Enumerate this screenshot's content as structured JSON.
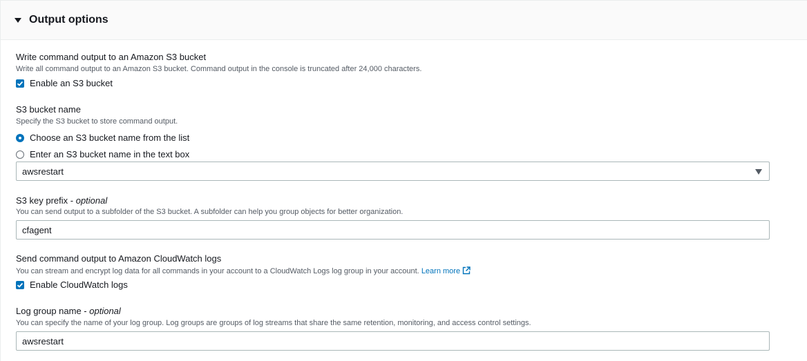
{
  "header": {
    "title": "Output options"
  },
  "s3_output": {
    "label": "Write command output to an Amazon S3 bucket",
    "description": "Write all command output to an Amazon S3 bucket. Command output in the console is truncated after 24,000 characters.",
    "checkbox_label": "Enable an S3 bucket",
    "checked": true
  },
  "bucket_name": {
    "label": "S3 bucket name",
    "description": "Specify the S3 bucket to store command output.",
    "options": [
      {
        "label": "Choose an S3 bucket name from the list",
        "selected": true
      },
      {
        "label": "Enter an S3 bucket name in the text box",
        "selected": false
      }
    ],
    "select_value": "awsrestart"
  },
  "key_prefix": {
    "label": "S3 key prefix",
    "optional": "optional",
    "description": "You can send output to a subfolder of the S3 bucket. A subfolder can help you group objects for better organization.",
    "value": "cfagent"
  },
  "cloudwatch": {
    "label": "Send command output to Amazon CloudWatch logs",
    "description": "You can stream and encrypt log data for all commands in your account to a CloudWatch Logs log group in your account.",
    "learn_more": "Learn more",
    "checkbox_label": "Enable CloudWatch logs",
    "checked": true
  },
  "log_group": {
    "label": "Log group name",
    "optional": "optional",
    "description": "You can specify the name of your log group. Log groups are groups of log streams that share the same retention, monitoring, and access control settings.",
    "value": "awsrestart"
  },
  "colors": {
    "accent": "#0073bb",
    "text": "#16191f",
    "muted": "#545b64",
    "border": "#aab7b8"
  }
}
